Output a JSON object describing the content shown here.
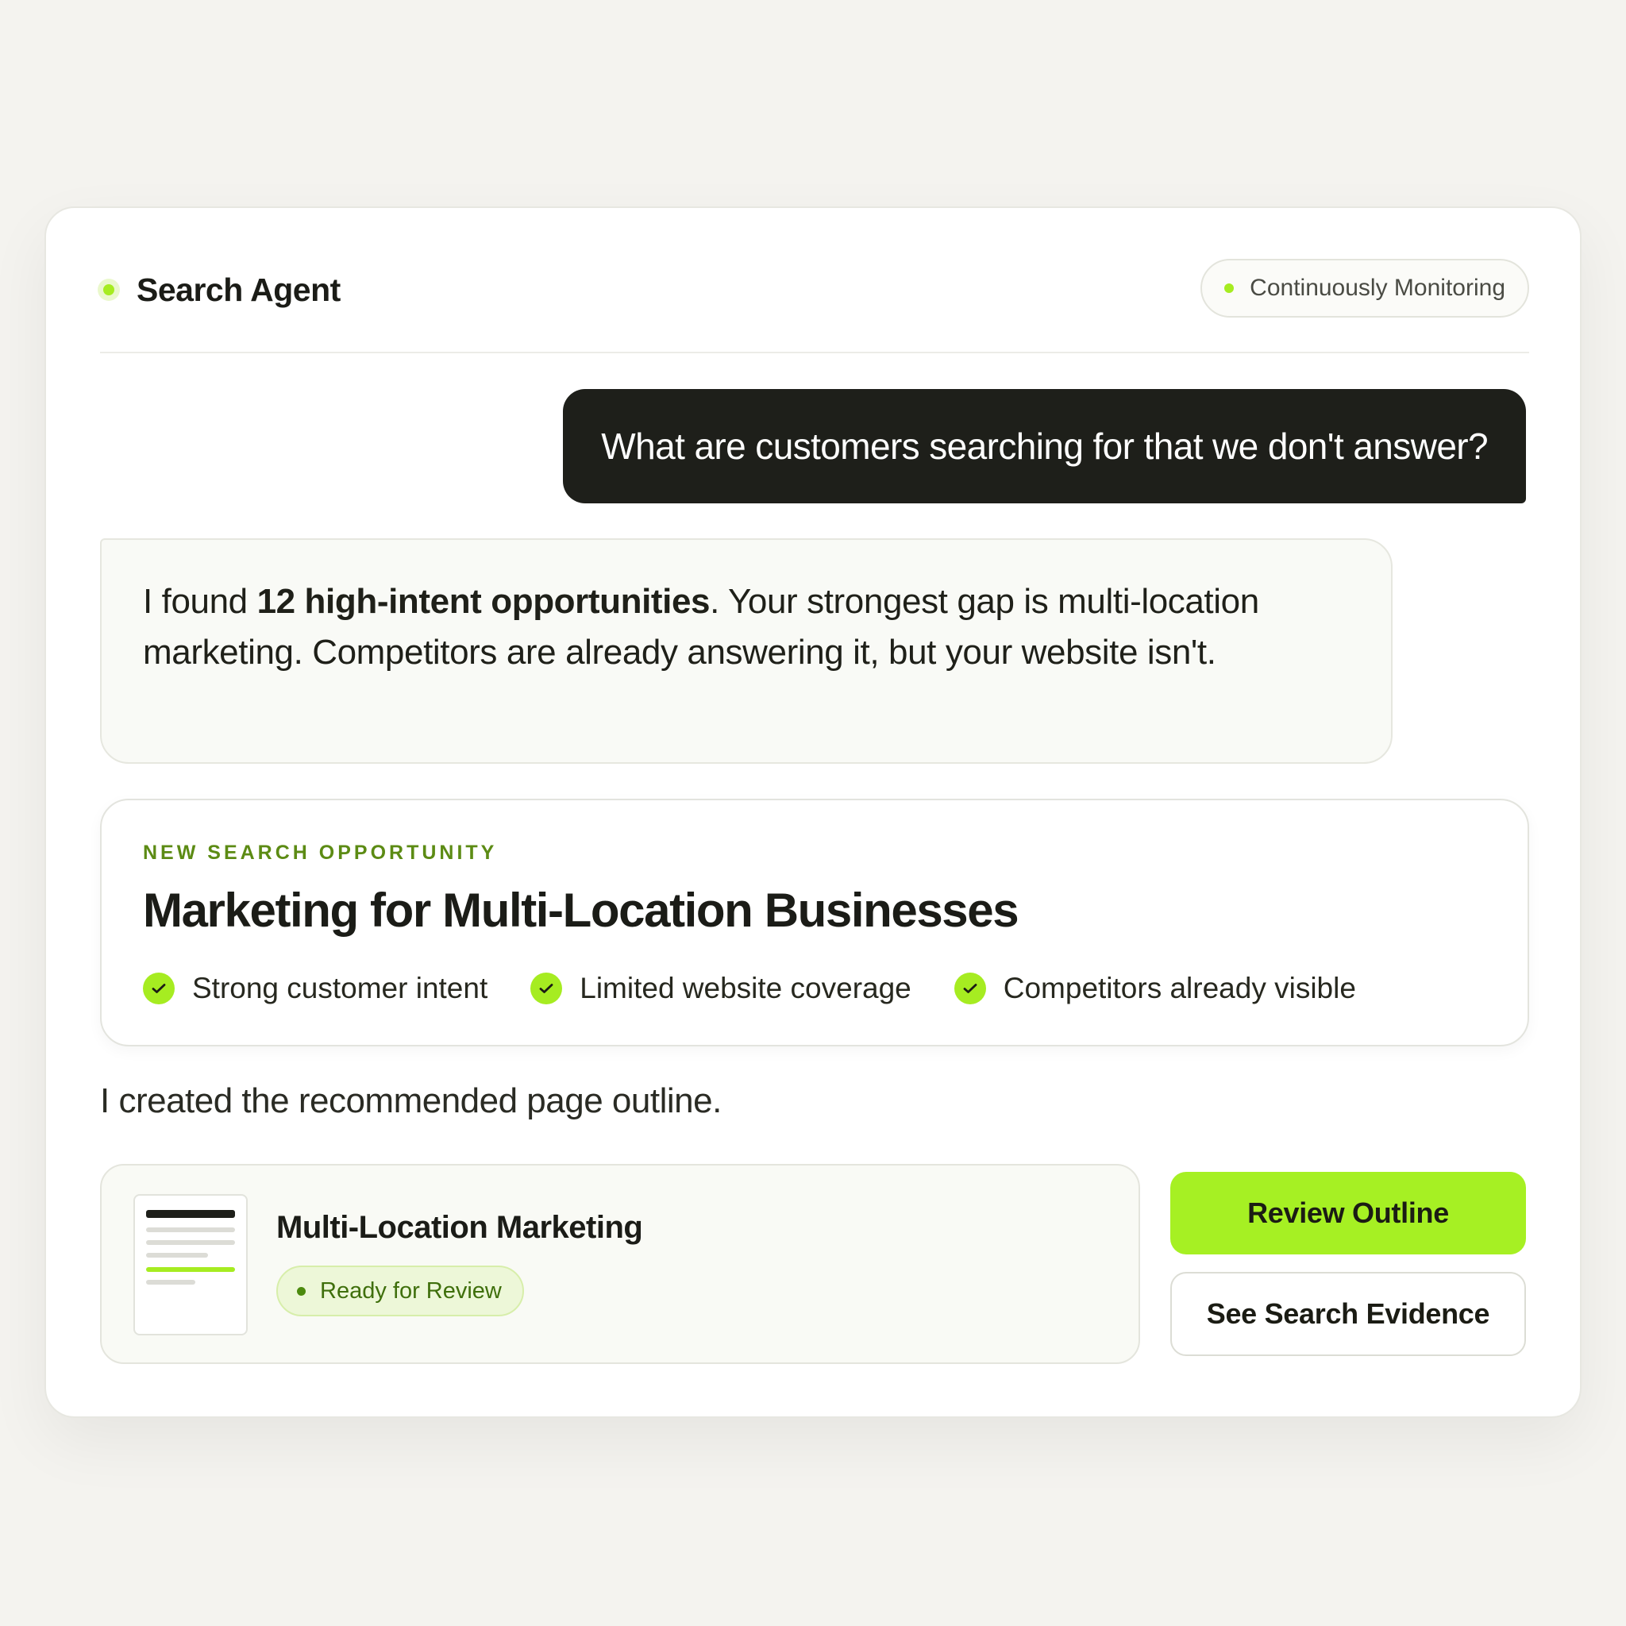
{
  "header": {
    "agent_name": "Search Agent",
    "status": "Continuously Monitoring"
  },
  "conversation": {
    "user_message": "What are customers searching for that we don't answer?",
    "agent_reply": {
      "prefix": "I found ",
      "highlight": "12 high-intent opportunities",
      "suffix": ". Your strongest gap is multi-location marketing. Competitors are already answering it, but your website isn't."
    }
  },
  "opportunity": {
    "eyebrow": "NEW SEARCH OPPORTUNITY",
    "title": "Marketing for Multi-Location Businesses",
    "checks": [
      "Strong customer intent",
      "Limited website coverage",
      "Competitors already visible"
    ]
  },
  "outline": {
    "intro": "I created the recommended page outline.",
    "name": "Multi-Location Marketing",
    "status": "Ready for Review"
  },
  "actions": {
    "primary_label": "Review Outline",
    "secondary_label": "See Search Evidence"
  },
  "colors": {
    "accent": "#a6ec21",
    "dark": "#1e1f1a",
    "eyebrow": "#5c8b14",
    "background": "#f4f3ef"
  },
  "icons": {
    "check": "check-circle-icon",
    "document": "document-thumbnail-icon",
    "status_dot": "status-dot-icon"
  }
}
